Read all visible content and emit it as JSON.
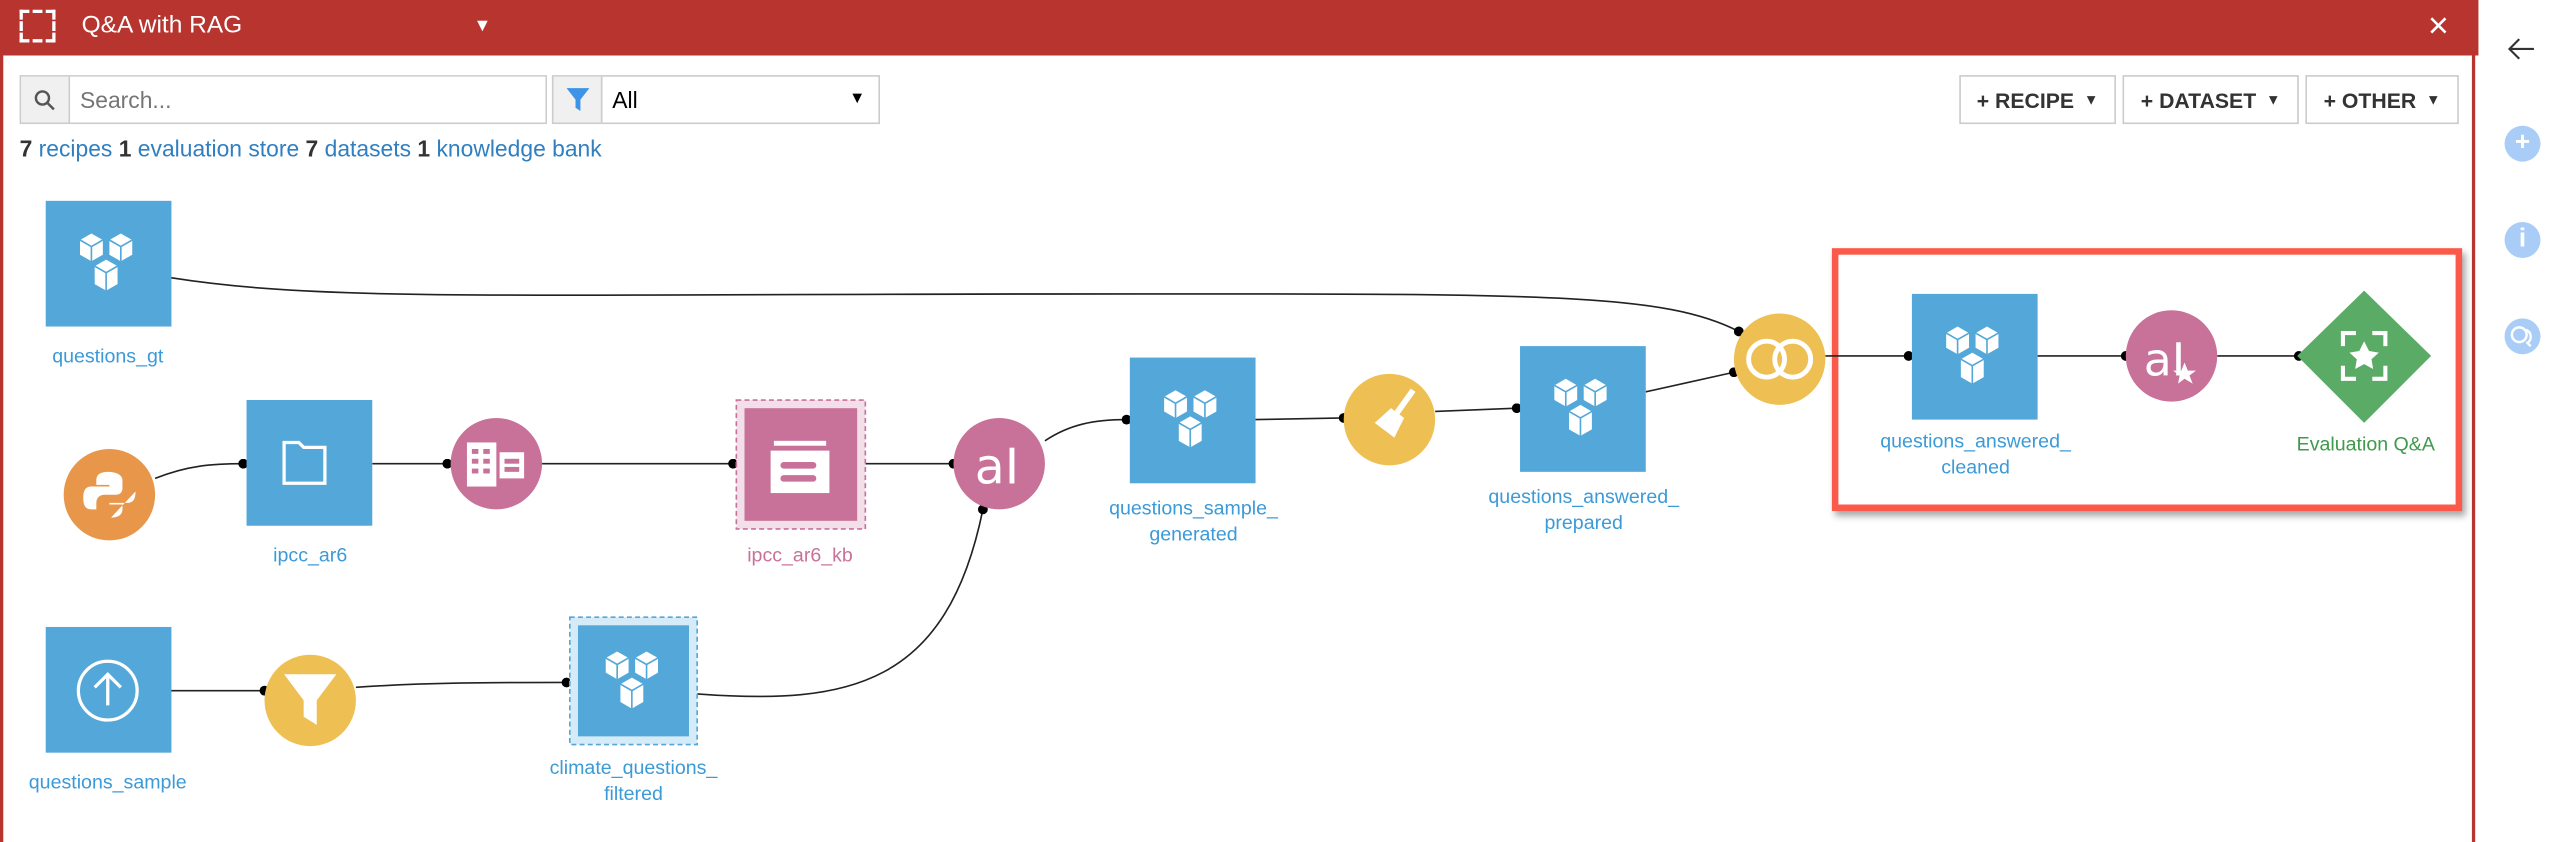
{
  "header": {
    "title": "Q&A with RAG",
    "close_label": "×"
  },
  "toolbar": {
    "search_placeholder": "Search...",
    "filter_value": "All",
    "buttons": {
      "recipe": "+ RECIPE",
      "dataset": "+ DATASET",
      "other": "+ OTHER"
    }
  },
  "stats": [
    {
      "count": "7",
      "label": "recipes"
    },
    {
      "count": "1",
      "label": "evaluation store"
    },
    {
      "count": "7",
      "label": "datasets"
    },
    {
      "count": "1",
      "label": "knowledge bank"
    }
  ],
  "sidebar": {
    "icons": [
      "back-arrow-icon",
      "plus-icon",
      "info-icon",
      "chat-icon"
    ]
  },
  "nodes": {
    "questions_gt": "questions_gt",
    "ipcc_ar6": "ipcc_ar6",
    "ipcc_ar6_kb": "ipcc_ar6_kb",
    "questions_sample_generated": [
      "questions_sample_",
      "generated"
    ],
    "questions_answered_prepared": [
      "questions_answered_",
      "prepared"
    ],
    "questions_answered_cleaned": [
      "questions_answered_",
      "cleaned"
    ],
    "evaluation": "Evaluation Q&A",
    "questions_sample": "questions_sample",
    "climate_questions_filtered": [
      "climate_questions_",
      "filtered"
    ]
  },
  "colors": {
    "header": "#b8352f",
    "dataset": "#53a7d9",
    "recipe_code": "#e8964a",
    "recipe_visual": "#eebf53",
    "recipe_llm": "#c8729a",
    "evaluation_store": "#5aab65",
    "highlight": "#fb5a4b"
  }
}
